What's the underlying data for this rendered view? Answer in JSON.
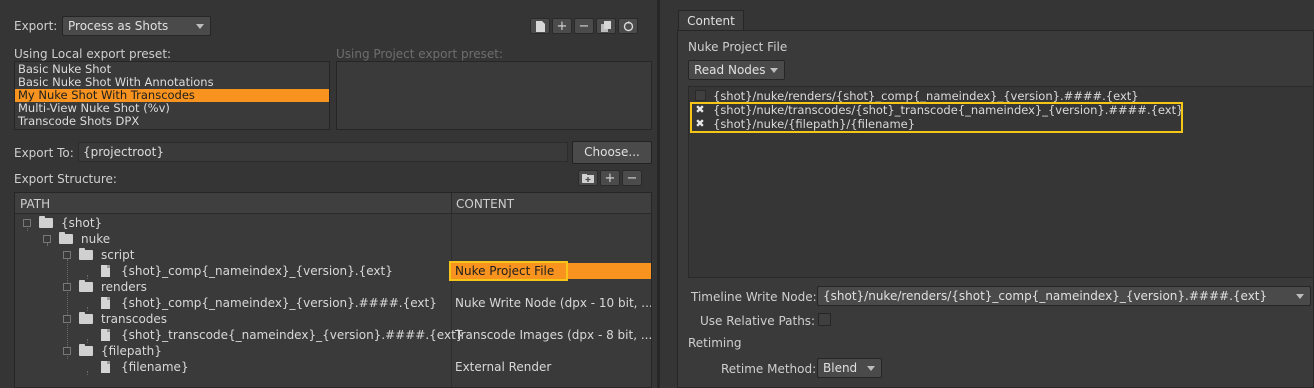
{
  "left": {
    "export_label": "Export:",
    "export_value": "Process as Shots",
    "toolbar_icons": [
      "new-preset-icon",
      "add-icon",
      "remove-icon",
      "copy-icon",
      "reset-icon"
    ],
    "local_preset_label": "Using Local export preset:",
    "project_preset_label": "Using Project export preset:",
    "local_presets": [
      {
        "label": "Basic Nuke Shot",
        "selected": false
      },
      {
        "label": "Basic Nuke Shot With Annotations",
        "selected": false
      },
      {
        "label": "My Nuke Shot With Transcodes",
        "selected": true
      },
      {
        "label": "Multi-View Nuke Shot (%v)",
        "selected": false
      },
      {
        "label": "Transcode Shots DPX",
        "selected": false
      }
    ],
    "export_to_label": "Export To:",
    "export_to_value": "{projectroot}",
    "choose_label": "Choose...",
    "structure_label": "Export Structure:",
    "columns": {
      "path": "PATH",
      "content": "CONTENT"
    },
    "tree": [
      {
        "depth": 0,
        "type": "folder",
        "name": "{shot}",
        "content": ""
      },
      {
        "depth": 1,
        "type": "folder",
        "name": "nuke",
        "content": ""
      },
      {
        "depth": 2,
        "type": "folder",
        "name": "script",
        "content": ""
      },
      {
        "depth": 3,
        "type": "file",
        "name": "{shot}_comp{_nameindex}_{version}.{ext}",
        "content": "Nuke Project File",
        "selected": true
      },
      {
        "depth": 2,
        "type": "folder",
        "name": "renders",
        "content": ""
      },
      {
        "depth": 3,
        "type": "file",
        "name": "{shot}_comp{_nameindex}_{version}.####.{ext}",
        "content": "Nuke Write Node (dpx - 10 bit, ..."
      },
      {
        "depth": 2,
        "type": "folder",
        "name": "transcodes",
        "content": ""
      },
      {
        "depth": 3,
        "type": "file",
        "name": "{shot}_transcode{_nameindex}_{version}.####.{ext}",
        "content": "Transcode Images (dpx - 8 bit, ..."
      },
      {
        "depth": 2,
        "type": "folder",
        "name": "{filepath}",
        "content": ""
      },
      {
        "depth": 3,
        "type": "file",
        "name": "{filename}",
        "content": "External Render"
      }
    ]
  },
  "right": {
    "tab_label": "Content",
    "section_title": "Nuke Project File",
    "read_nodes_label": "Read Nodes",
    "read_paths": [
      {
        "checked": false,
        "path": "{shot}/nuke/renders/{shot}_comp{_nameindex}_{version}.####.{ext}"
      },
      {
        "checked": true,
        "path": "{shot}/nuke/transcodes/{shot}_transcode{_nameindex}_{version}.####.{ext}"
      },
      {
        "checked": true,
        "path": "{shot}/nuke/{filepath}/{filename}"
      }
    ],
    "timeline_write_label": "Timeline Write Node:",
    "timeline_write_value": "{shot}/nuke/renders/{shot}_comp{_nameindex}_{version}.####.{ext}",
    "relative_paths_label": "Use Relative Paths:",
    "relative_paths_checked": false,
    "retiming_label": "Retiming",
    "retime_method_label": "Retime Method:",
    "retime_method_value": "Blend"
  },
  "colors": {
    "accent": "#f7931e",
    "highlight_box": "#f5c518",
    "background": "#353535"
  }
}
